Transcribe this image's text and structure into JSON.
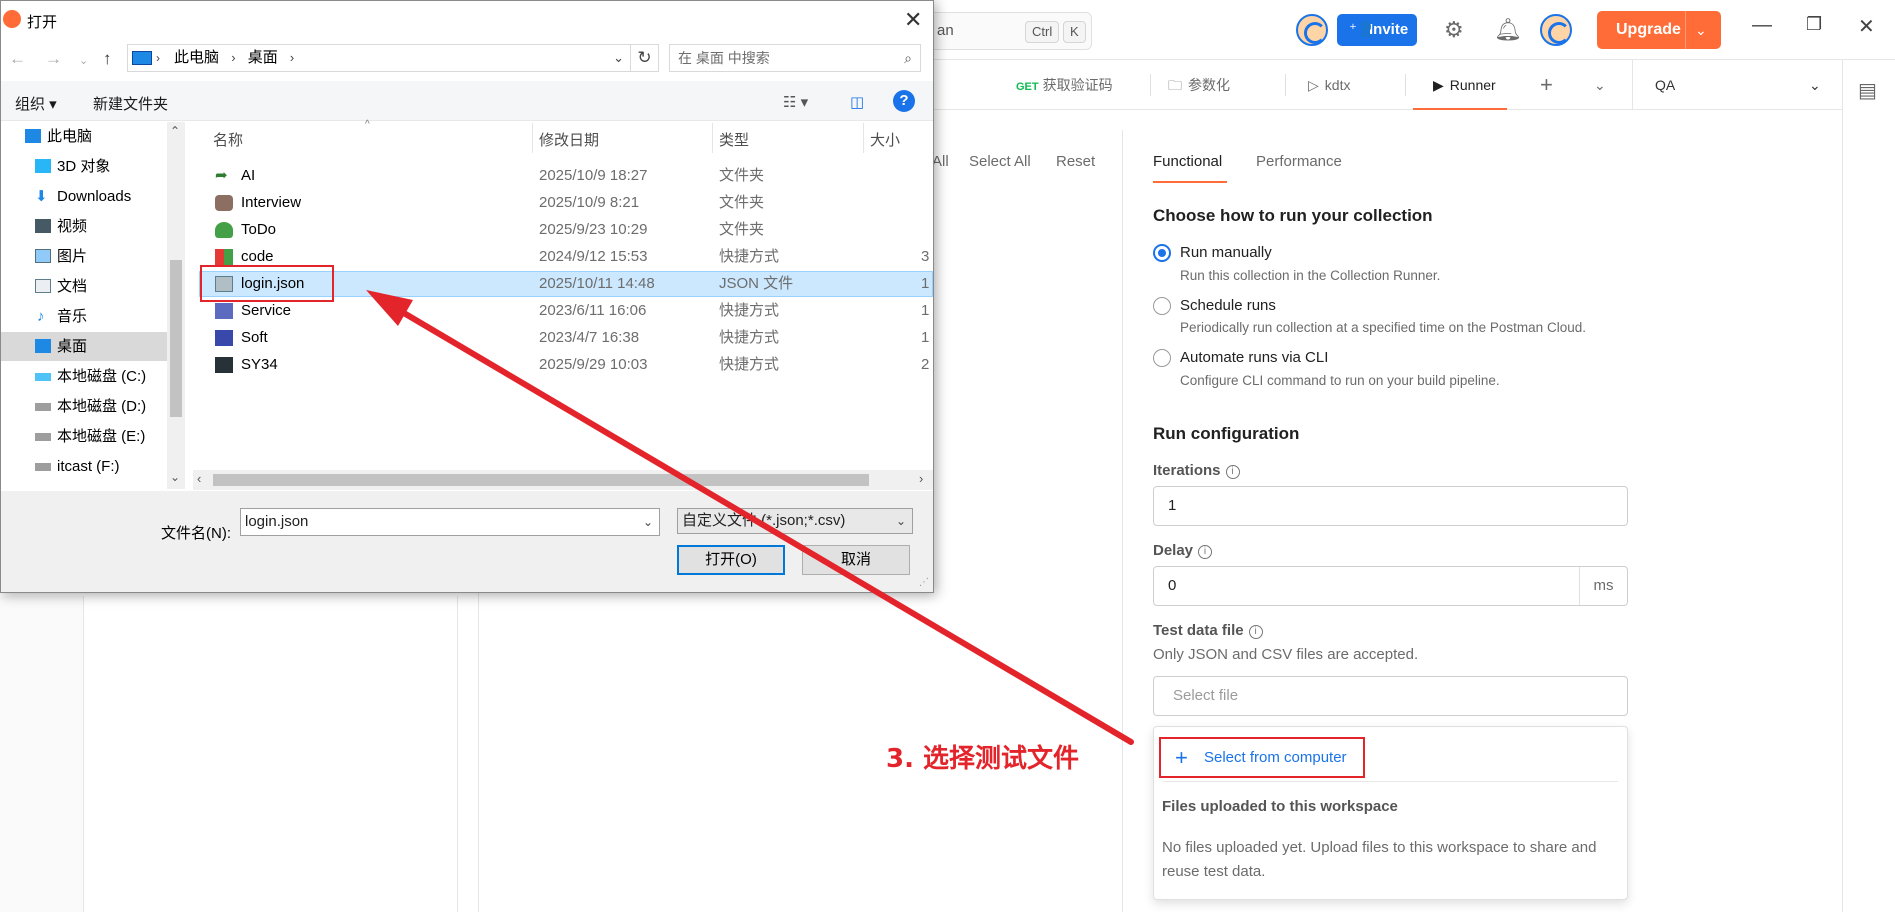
{
  "app": {
    "search": {
      "placeholder_partial": "an",
      "shortcut_ctrl": "Ctrl",
      "shortcut_key": "K"
    },
    "invite_label": "Invite",
    "upgrade_label": "Upgrade",
    "tabs": [
      {
        "label": "获取验证码",
        "method": "GET"
      },
      {
        "label": "参数化"
      },
      {
        "label": "kdtx"
      },
      {
        "label": "Runner",
        "active": true
      }
    ],
    "environment": "QA",
    "select_links": {
      "deselect_partial": "All",
      "select_all": "Select All",
      "reset": "Reset"
    },
    "runner": {
      "tabs": [
        "Functional",
        "Performance"
      ],
      "choose_heading": "Choose how to run your collection",
      "options": [
        {
          "title": "Run manually",
          "desc": "Run this collection in the Collection Runner.",
          "selected": true
        },
        {
          "title": "Schedule runs",
          "desc": "Periodically run collection at a specified time on the Postman Cloud.",
          "selected": false
        },
        {
          "title": "Automate runs via CLI",
          "desc": "Configure CLI command to run on your build pipeline.",
          "selected": false
        }
      ],
      "config_heading": "Run configuration",
      "iterations_label": "Iterations",
      "iterations_value": "1",
      "delay_label": "Delay",
      "delay_value": "0",
      "delay_unit": "ms",
      "test_data_label": "Test data file",
      "test_data_desc": "Only JSON and CSV files are accepted.",
      "select_file_placeholder": "Select file",
      "select_from_computer": "Select from computer",
      "uploaded_heading": "Files uploaded to this workspace",
      "uploaded_desc": "No files uploaded yet. Upload files to this workspace to share and reuse test data."
    }
  },
  "annotation": {
    "text": "3. 选择测试文件",
    "color": "#e3242b"
  },
  "dialog": {
    "title": "打开",
    "breadcrumb": [
      "此电脑",
      "桌面"
    ],
    "search_placeholder": "在 桌面 中搜索",
    "toolbar": {
      "organize": "组织 ▾",
      "new_folder": "新建文件夹"
    },
    "nav_items": [
      {
        "label": "此电脑",
        "icon": "computer-icon"
      },
      {
        "label": "3D 对象",
        "icon": "3d-objects-icon"
      },
      {
        "label": "Downloads",
        "icon": "download-icon"
      },
      {
        "label": "视频",
        "icon": "video-icon"
      },
      {
        "label": "图片",
        "icon": "picture-icon"
      },
      {
        "label": "文档",
        "icon": "document-icon"
      },
      {
        "label": "音乐",
        "icon": "music-icon"
      },
      {
        "label": "桌面",
        "icon": "desktop-icon",
        "selected": true
      },
      {
        "label": "本地磁盘 (C:)",
        "icon": "drive-icon"
      },
      {
        "label": "本地磁盘 (D:)",
        "icon": "drive-icon"
      },
      {
        "label": "本地磁盘 (E:)",
        "icon": "drive-icon"
      },
      {
        "label": "itcast (F:)",
        "icon": "drive-icon"
      }
    ],
    "columns": [
      "名称",
      "修改日期",
      "类型",
      "大小"
    ],
    "files": [
      {
        "name": "AI",
        "date": "2025/10/9 18:27",
        "type": "文件夹",
        "size": ""
      },
      {
        "name": "Interview",
        "date": "2025/10/9 8:21",
        "type": "文件夹",
        "size": ""
      },
      {
        "name": "ToDo",
        "date": "2025/9/23 10:29",
        "type": "文件夹",
        "size": ""
      },
      {
        "name": "code",
        "date": "2024/9/12 15:53",
        "type": "快捷方式",
        "size": "3"
      },
      {
        "name": "login.json",
        "date": "2025/10/11 14:48",
        "type": "JSON 文件",
        "size": "1",
        "selected": true
      },
      {
        "name": "Service",
        "date": "2023/6/11 16:06",
        "type": "快捷方式",
        "size": "1"
      },
      {
        "name": "Soft",
        "date": "2023/4/7 16:38",
        "type": "快捷方式",
        "size": "1"
      },
      {
        "name": "SY34",
        "date": "2025/9/29 10:03",
        "type": "快捷方式",
        "size": "2"
      }
    ],
    "filename_label": "文件名(N):",
    "filename_value": "login.json",
    "filetype_value": "自定义文件 (*.json;*.csv)",
    "open_button": "打开(O)",
    "cancel_button": "取消"
  }
}
